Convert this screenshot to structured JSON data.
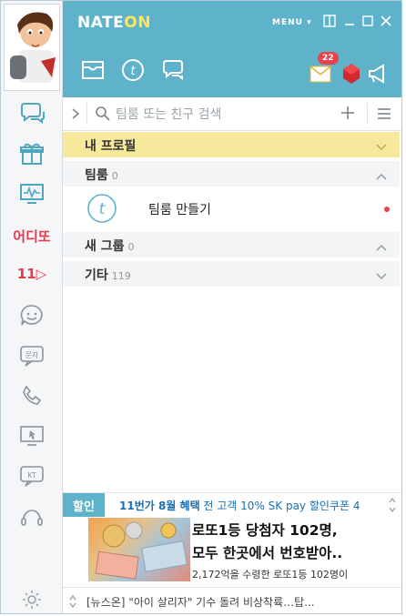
{
  "app": {
    "logo_part1": "NATE",
    "logo_part2": "ON",
    "menu_label": "MENU ▾"
  },
  "header": {
    "notification_count": "22"
  },
  "rail": {
    "place_label": "어디또",
    "shop_label": "11▷"
  },
  "search": {
    "placeholder": "팀룸 또는 친구 검색"
  },
  "groups": {
    "profile": {
      "title": "내 프로필"
    },
    "team": {
      "title": "팀룸",
      "count": "0"
    },
    "make_team": {
      "label": "팀룸 만들기"
    },
    "new_group": {
      "title": "새 그룹",
      "count": "0"
    },
    "etc": {
      "title": "기타",
      "count": "119"
    }
  },
  "ad": {
    "tag": "할인",
    "promo_bold": "11번가 8월 혜택",
    "promo_rest": " 전 고객 10% SK pay 할인쿠폰 4",
    "headline1": "로또1등 당첨자 102명,",
    "headline2": "모두 한곳에서 번호받아..",
    "sub": "2,172억을 수령한 로또1등 102명이"
  },
  "news": {
    "text": "[뉴스온] \"아이 살리자\" 기수 돌려 비상착륙…탑..."
  },
  "colors": {
    "header": "#5eb2c9",
    "profile_bar": "#f7e99c",
    "logo_accent": "#ffe55a",
    "badge": "#e8434d"
  }
}
